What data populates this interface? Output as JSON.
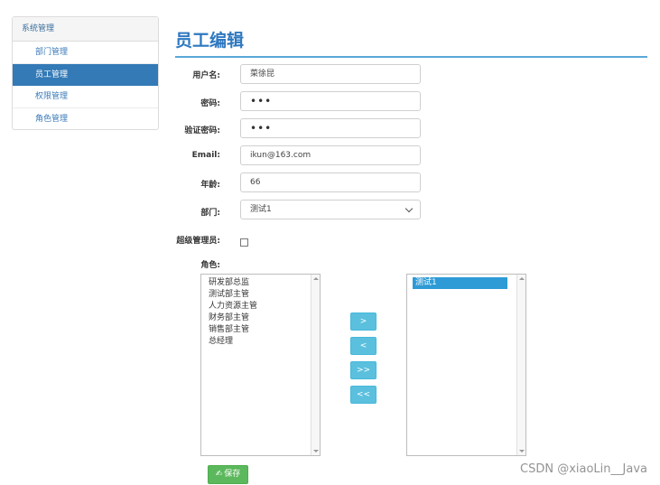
{
  "sidebar": {
    "header": "系统管理",
    "items": [
      {
        "label": "部门管理"
      },
      {
        "label": "员工管理"
      },
      {
        "label": "权限管理"
      },
      {
        "label": "角色管理"
      }
    ]
  },
  "page": {
    "title": "员工编辑"
  },
  "form": {
    "username_label": "用户名:",
    "username_value": "菜徐昆",
    "password_label": "密码:",
    "password_value": "•••",
    "confirm_label": "验证密码:",
    "confirm_value": "•••",
    "email_label": "Email:",
    "email_value": "ikun@163.com",
    "age_label": "年龄:",
    "age_value": "66",
    "dept_label": "部门:",
    "dept_value": "测试1",
    "admin_label": "超级管理员:",
    "role_label": "角色:"
  },
  "roles": {
    "available": [
      "研发部总监",
      "测试部主管",
      "人力资源主管",
      "财务部主管",
      "销售部主管",
      "总经理"
    ],
    "selected": [
      "测试1"
    ]
  },
  "buttons": {
    "move_right": ">",
    "move_left": "<",
    "move_all_right": ">>",
    "move_all_left": "<<",
    "save": "保存",
    "save_icon": "✍"
  },
  "watermark": "CSDN @xiaoLin__Java",
  "colors": {
    "primary": "#337ab7",
    "title": "#2e78c0",
    "info": "#5bc0de",
    "success": "#5cb85c"
  }
}
